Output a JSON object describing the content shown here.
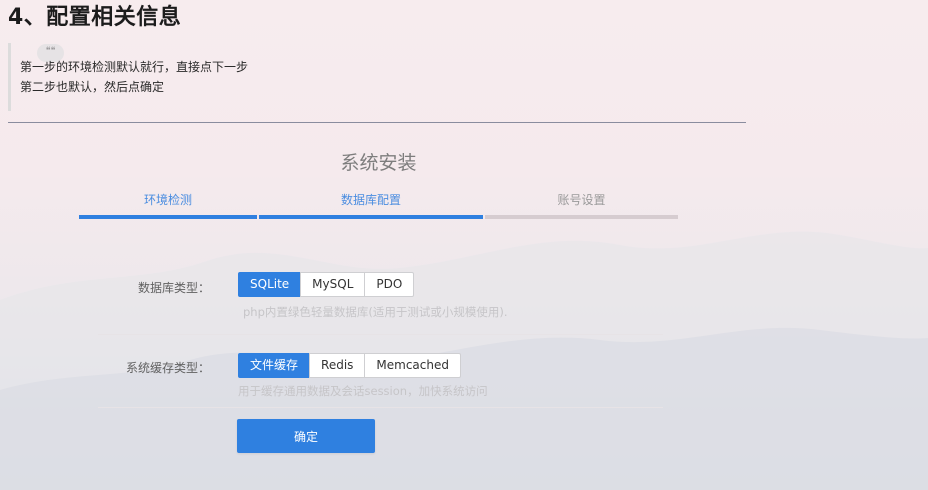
{
  "article": {
    "heading": "4、配置相关信息",
    "quote_icon": "quote-icon",
    "quote_lines": [
      "第一步的环境检测默认就行，直接点下一步",
      "第二步也默认，然后点确定"
    ]
  },
  "installer": {
    "title": "系统安装",
    "steps": [
      {
        "label": "环境检测",
        "state": "done"
      },
      {
        "label": "数据库配置",
        "state": "active"
      },
      {
        "label": "账号设置",
        "state": "pending"
      }
    ],
    "db_type": {
      "label": "数据库类型：",
      "options": [
        "SQLite",
        "MySQL",
        "PDO"
      ],
      "selected": "SQLite",
      "hint": "php内置绿色轻量数据库(适用于测试或小规模使用)."
    },
    "cache_type": {
      "label": "系统缓存类型：",
      "options": [
        "文件缓存",
        "Redis",
        "Memcached"
      ],
      "selected": "文件缓存",
      "hint": "用于缓存通用数据及会话session，加快系统访问"
    },
    "confirm_label": "确定"
  },
  "colors": {
    "accent": "#2f80e0",
    "step_active_text": "#4a8de0",
    "step_pending_text": "#9a9a9a",
    "step_pending_bar": "#d6ccd0"
  }
}
